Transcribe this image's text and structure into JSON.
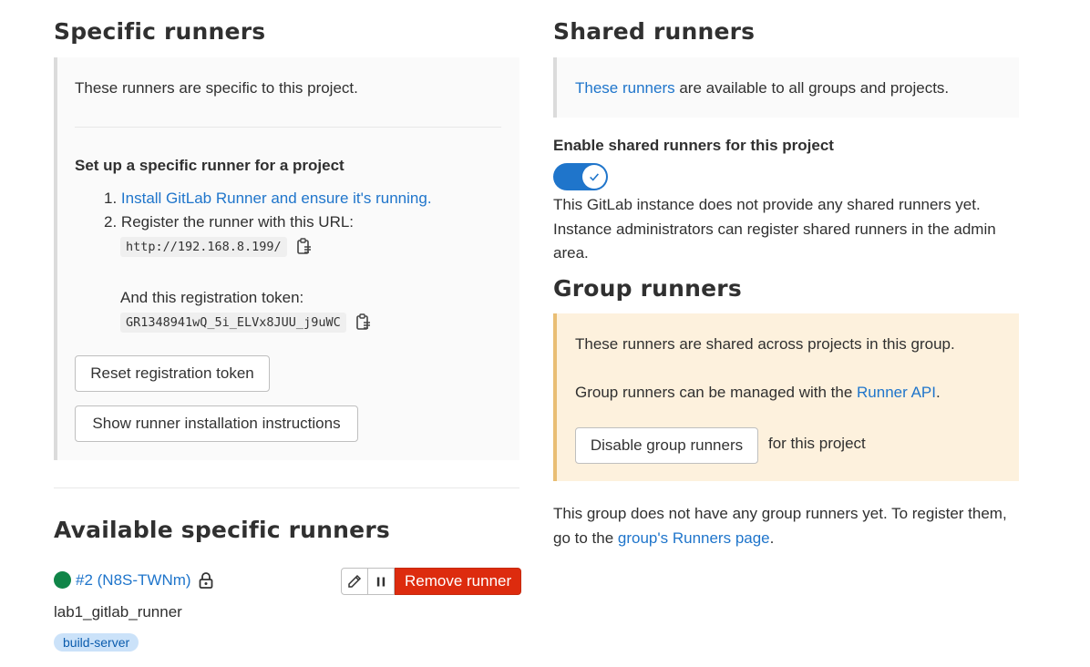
{
  "specific": {
    "title": "Specific runners",
    "intro": "These runners are specific to this project.",
    "setup_heading": "Set up a specific runner for a project",
    "step1_num": "1.",
    "step1_link": "Install GitLab Runner and ensure it's running.",
    "step2_num": "2.",
    "step2_text": "Register the runner with this URL:",
    "url": "http://192.168.8.199/",
    "token_label": "And this registration token:",
    "token": "GR1348941wQ_5i_ELVx8JUU_j9uWC",
    "reset_button": "Reset registration token",
    "instructions_button": "Show runner installation instructions"
  },
  "available": {
    "title": "Available specific runners",
    "runner": {
      "id_link": "#2 (N8S-TWNm)",
      "description": "lab1_gitlab_runner",
      "tag": "build-server",
      "status_color": "#108548",
      "remove_button": "Remove runner"
    }
  },
  "shared": {
    "title": "Shared runners",
    "info_link": "These runners",
    "info_rest": " are available to all groups and projects.",
    "toggle_label": "Enable shared runners for this project",
    "toggle_on": true,
    "note": "This GitLab instance does not provide any shared runners yet. Instance administrators can register shared runners in the admin area."
  },
  "group": {
    "title": "Group runners",
    "shared_text": "These runners are shared across projects in this group.",
    "managed_prefix": "Group runners can be managed with the ",
    "managed_link": "Runner API",
    "managed_suffix": ".",
    "disable_button": "Disable group runners",
    "disable_suffix": "for this project",
    "none_prefix": "This group does not have any group runners yet. To register them, go to the ",
    "none_link": "group's Runners page",
    "none_suffix": "."
  },
  "colors": {
    "link": "#1f75cb",
    "danger": "#dd2b0e",
    "toggle": "#1f75cb",
    "warning_bg": "#fdf1dd"
  }
}
